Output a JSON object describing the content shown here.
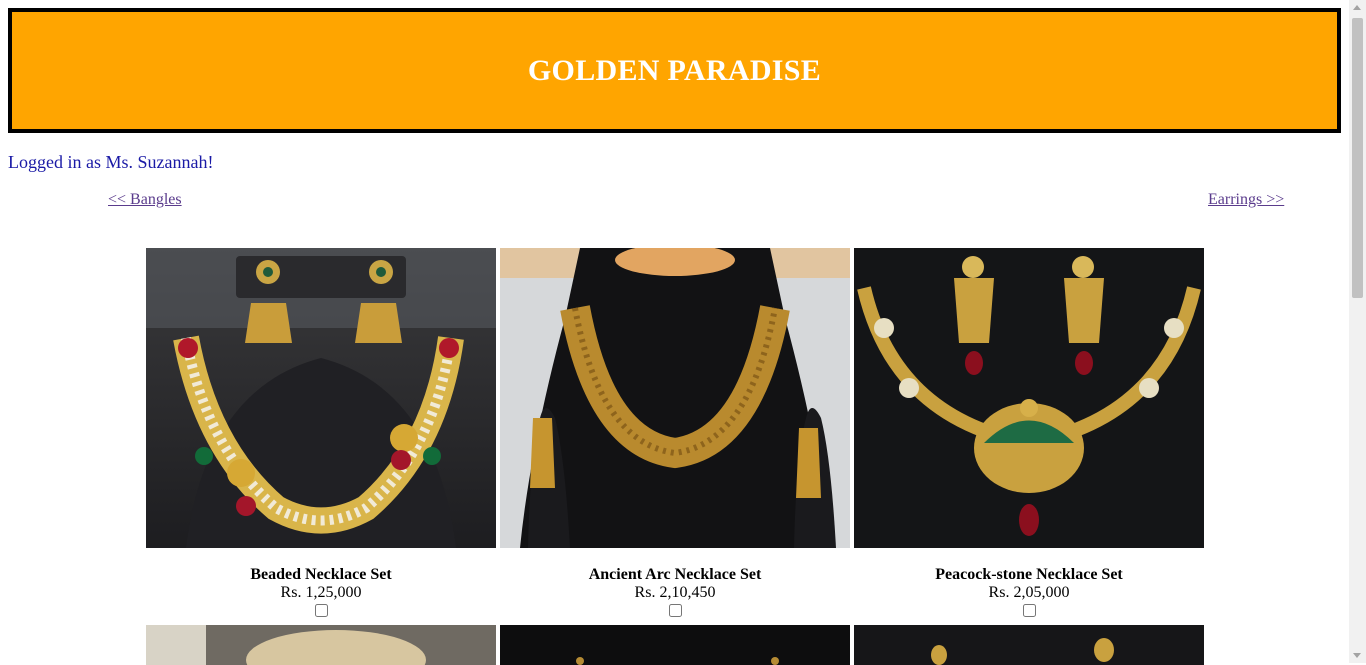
{
  "header": {
    "title": "GOLDEN PARADISE"
  },
  "user": {
    "login_text": "Logged in as Ms. Suzannah!"
  },
  "nav": {
    "prev_label": "<< Bangles",
    "next_label": "Earrings >>"
  },
  "products": [
    {
      "name": "Beaded Necklace Set",
      "price": "Rs. 1,25,000"
    },
    {
      "name": "Ancient Arc Necklace Set",
      "price": "Rs. 2,10,450"
    },
    {
      "name": "Peacock-stone Necklace Set",
      "price": "Rs. 2,05,000"
    }
  ],
  "colors": {
    "header_bg": "#FFA500",
    "header_border": "#000000",
    "login_text": "#1a1aa6",
    "link": "#5a3b8c"
  }
}
